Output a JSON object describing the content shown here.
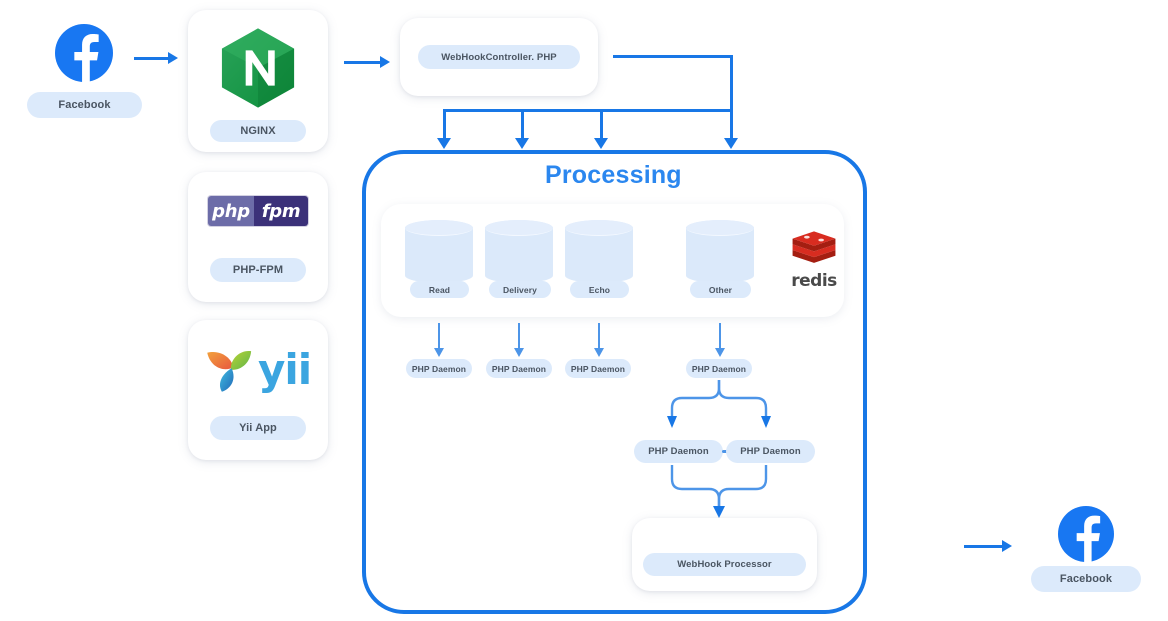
{
  "diagram": {
    "title": "Processing",
    "source": {
      "label": "Facebook",
      "icon": "facebook-icon"
    },
    "gateway": {
      "label": "NGINX",
      "icon": "nginx-logo-icon"
    },
    "runtime_cards": [
      {
        "label": "PHP-FPM",
        "icon": "php-fpm-logo-icon",
        "logo_left": "php",
        "logo_right": "fpm"
      },
      {
        "label": "Yii App",
        "icon": "yii-logo-icon",
        "logo_text": "yii"
      }
    ],
    "controller": {
      "label": "WebHookController. PHP"
    },
    "queues": [
      {
        "label": "Read",
        "icon": "database-cylinder-icon"
      },
      {
        "label": "Delivery",
        "icon": "database-cylinder-icon"
      },
      {
        "label": "Echo",
        "icon": "database-cylinder-icon"
      },
      {
        "label": "Other",
        "icon": "database-cylinder-icon"
      }
    ],
    "store": {
      "label": "redis",
      "icon": "redis-logo-icon"
    },
    "daemons_row": [
      {
        "label": "PHP Daemon"
      },
      {
        "label": "PHP Daemon"
      },
      {
        "label": "PHP Daemon"
      },
      {
        "label": "PHP Daemon"
      }
    ],
    "daemon_pair": [
      {
        "label": "PHP Daemon"
      },
      {
        "label": "PHP Daemon"
      }
    ],
    "processor": {
      "label": "WebHook Processor"
    },
    "sink": {
      "label": "Facebook",
      "icon": "facebook-icon"
    },
    "colors": {
      "accent_blue": "#1877e6",
      "title_blue": "#2b87ef",
      "pill_bg": "#dceafb",
      "facebook_blue": "#1877f2",
      "nginx_green": "#159a43",
      "redis_red": "#d42f28",
      "yii_blue": "#3ba5e0",
      "phpfpm_purple": "#3b3179"
    }
  }
}
